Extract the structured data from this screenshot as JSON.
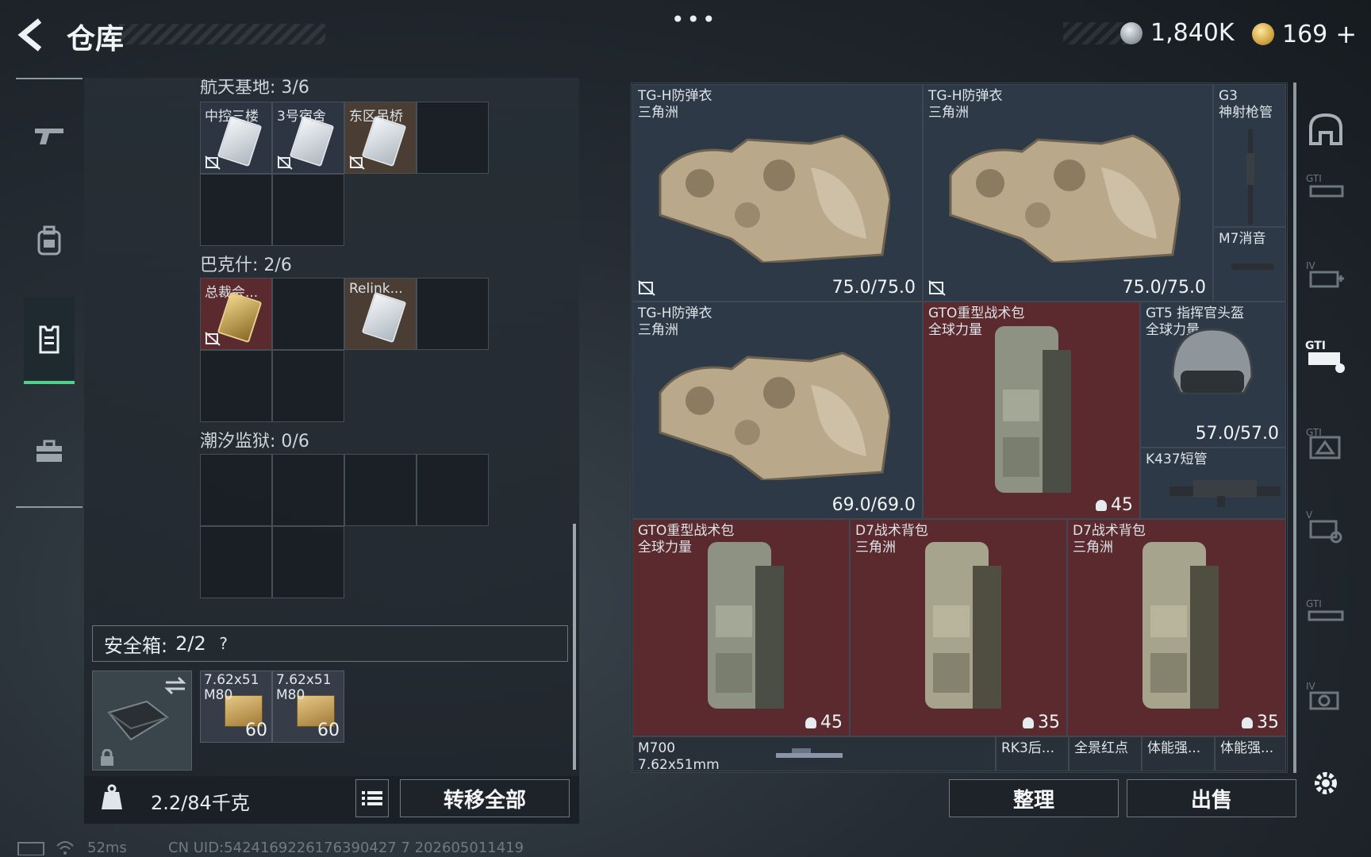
{
  "header": {
    "title": "仓库",
    "dots": "•••",
    "silver_amount": "1,840K",
    "gold_amount": "169",
    "gold_plus": "+"
  },
  "nav": {
    "items": [
      "gun-icon",
      "backpack-icon",
      "vest-icon",
      "toolbox-icon"
    ],
    "active_index": 2
  },
  "storage": {
    "partial_label": "航天基地: 3/6",
    "sections": [
      {
        "label": "巴克什: 2/6",
        "items": [
          {
            "name": "总裁会...",
            "color": "red"
          },
          {
            "name": "Relink...",
            "color": "brown"
          }
        ]
      },
      {
        "label": "潮汐监狱: 0/6"
      }
    ],
    "top_items": [
      {
        "name": "中控三楼",
        "color": "blue"
      },
      {
        "name": "3号宿舍",
        "color": "blue"
      },
      {
        "name": "东区吊桥",
        "color": "brown"
      }
    ]
  },
  "safebox": {
    "label": "安全箱:",
    "count": "2/2",
    "help": "?",
    "ammo": [
      {
        "line1": "7.62x51",
        "line2": "M80",
        "count": "60"
      },
      {
        "line1": "7.62x51",
        "line2": "M80",
        "count": "60"
      }
    ]
  },
  "bottom": {
    "weight": "2.2/84千克",
    "transfer_all": "转移全部",
    "sort": "整理",
    "sell": "出售"
  },
  "status_bar": {
    "ping": "52ms",
    "uid": "CN UID:5424169226176390427 7 202605011419"
  },
  "items": {
    "vest1": {
      "name": "TG-H防弹衣",
      "sub": "三角洲",
      "durability": "75.0/75.0"
    },
    "vest2": {
      "name": "TG-H防弹衣",
      "sub": "三角洲",
      "durability": "75.0/75.0"
    },
    "vest3": {
      "name": "TG-H防弹衣",
      "sub": "三角洲",
      "durability": "69.0/69.0"
    },
    "g3": {
      "name": "G3",
      "sub": "神射枪管"
    },
    "m7": {
      "name": "M7消音"
    },
    "gto1": {
      "name": "GTO重型战术包",
      "sub": "全球力量",
      "capacity": "45"
    },
    "gt5": {
      "name": "GT5 指挥官头盔",
      "sub": "全球力量",
      "durability": "57.0/57.0"
    },
    "k437": {
      "name": "K437短管"
    },
    "gto2": {
      "name": "GTO重型战术包",
      "sub": "全球力量",
      "capacity": "45"
    },
    "d7a": {
      "name": "D7战术背包",
      "sub": "三角洲",
      "capacity": "35"
    },
    "d7b": {
      "name": "D7战术背包",
      "sub": "三角洲",
      "capacity": "35"
    },
    "m700": {
      "name": "M700",
      "sub": "7.62x51mm"
    },
    "rk3": {
      "name": "RK3后..."
    },
    "redot": {
      "name": "全景红点"
    },
    "tineng1": {
      "name": "体能强..."
    },
    "tineng2": {
      "name": "体能强..."
    }
  },
  "side_filters": [
    "helmet-icon",
    "gti-rifle-icon",
    "iv-medkit-icon",
    "gti-case-icon",
    "gti-box-icon",
    "v-kit-icon",
    "gti-gun-icon",
    "iv-cam-icon",
    "settings-icon"
  ],
  "colors": {
    "accent_green": "#52d18b",
    "item_red": "#5a2a2f",
    "item_blue": "#2d3947"
  }
}
